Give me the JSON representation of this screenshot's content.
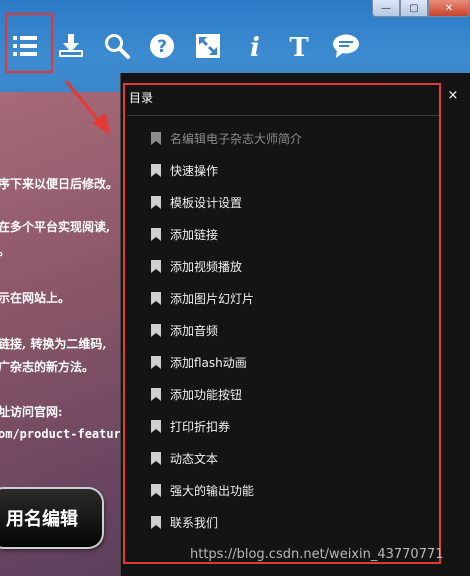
{
  "window": {
    "minimize_glyph": "—",
    "maximize_glyph": "▢",
    "close_glyph": "✕"
  },
  "toolbar": {
    "icons": [
      "list-icon",
      "download-icon",
      "search-icon",
      "help-icon",
      "fullscreen-icon",
      "info-icon",
      "text-icon",
      "comment-icon"
    ]
  },
  "background_text": [
    "序下来以便日后修改。",
    "在多个平台实现阅读,",
    "。",
    "示在网站上。",
    "链接, 转换为二维码,",
    "广杂志的新方法。",
    "址访问官网:",
    "om/product-features",
    "用名编辑"
  ],
  "toc": {
    "title": "目录",
    "close": "×",
    "items": [
      {
        "label": "名编辑电子杂志大师简介",
        "active": false
      },
      {
        "label": "快速操作",
        "active": true
      },
      {
        "label": "模板设计设置",
        "active": true
      },
      {
        "label": "添加链接",
        "active": true
      },
      {
        "label": "添加视频播放",
        "active": true
      },
      {
        "label": "添加图片幻灯片",
        "active": true
      },
      {
        "label": "添加音频",
        "active": true
      },
      {
        "label": "添加flash动画",
        "active": true
      },
      {
        "label": "添加功能按钮",
        "active": true
      },
      {
        "label": "打印折扣券",
        "active": true
      },
      {
        "label": "动态文本",
        "active": true
      },
      {
        "label": "强大的输出功能",
        "active": true
      },
      {
        "label": "联系我们",
        "active": true
      }
    ]
  },
  "watermark": "https://blog.csdn.net/weixin_43770771",
  "colors": {
    "toolbar": "#3a86c9",
    "highlight": "#e33a34",
    "panel": "#141414"
  }
}
